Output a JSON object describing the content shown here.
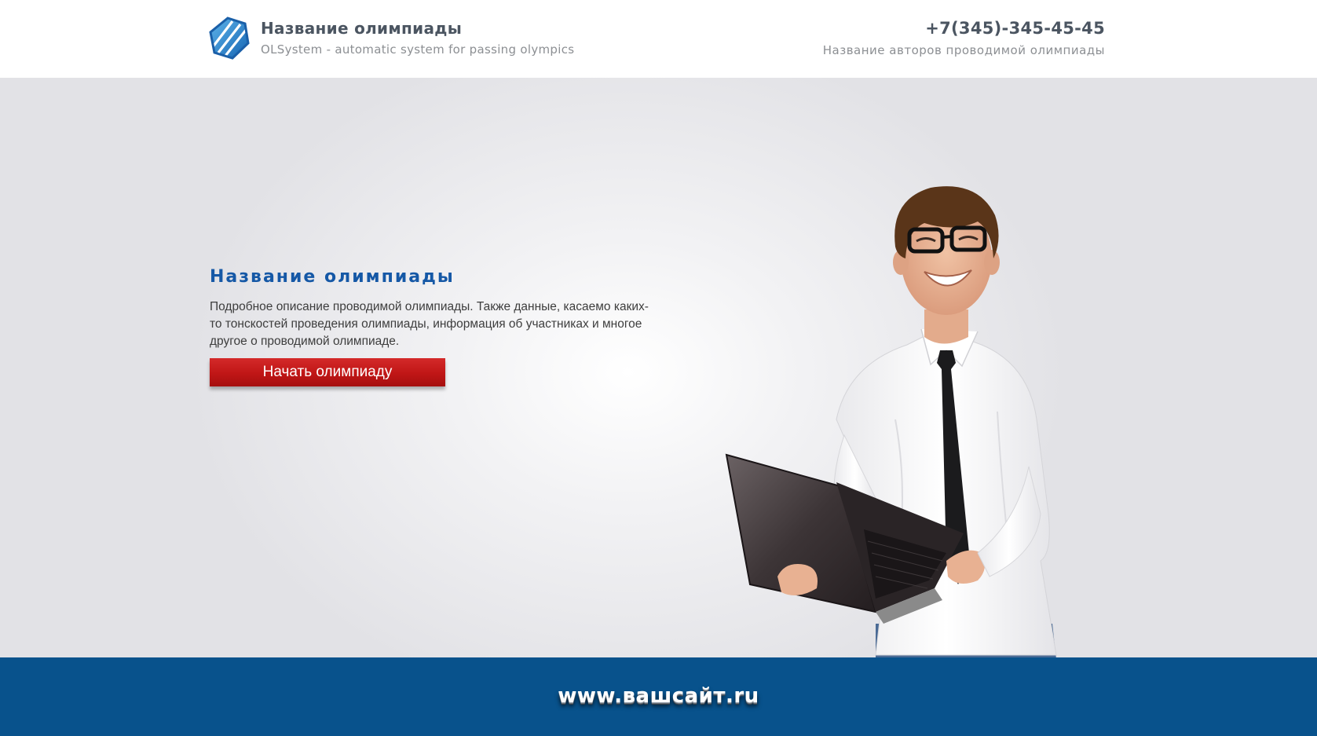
{
  "header": {
    "title": "Название олимпиады",
    "subtitle": "OLSystem - automatic system for passing olympics",
    "phone": "+7(345)-345-45-45",
    "authors": "Название авторов проводимой олимпиады"
  },
  "hero": {
    "title": "Название олимпиады",
    "description": "Подробное описание проводимой олимпиады. Также данные, касаемо каких-то тонскостей проведения олимпиады, информация об участниках и многое другое о проводимой олимпиаде.",
    "start_button_label": "Начать олимпиаду"
  },
  "footer": {
    "url": "www.вашсайт.ru"
  },
  "colors": {
    "accent_blue": "#1558a6",
    "button_red": "#c01616",
    "footer_blue": "#08528c",
    "text_gray": "#4b5561"
  }
}
